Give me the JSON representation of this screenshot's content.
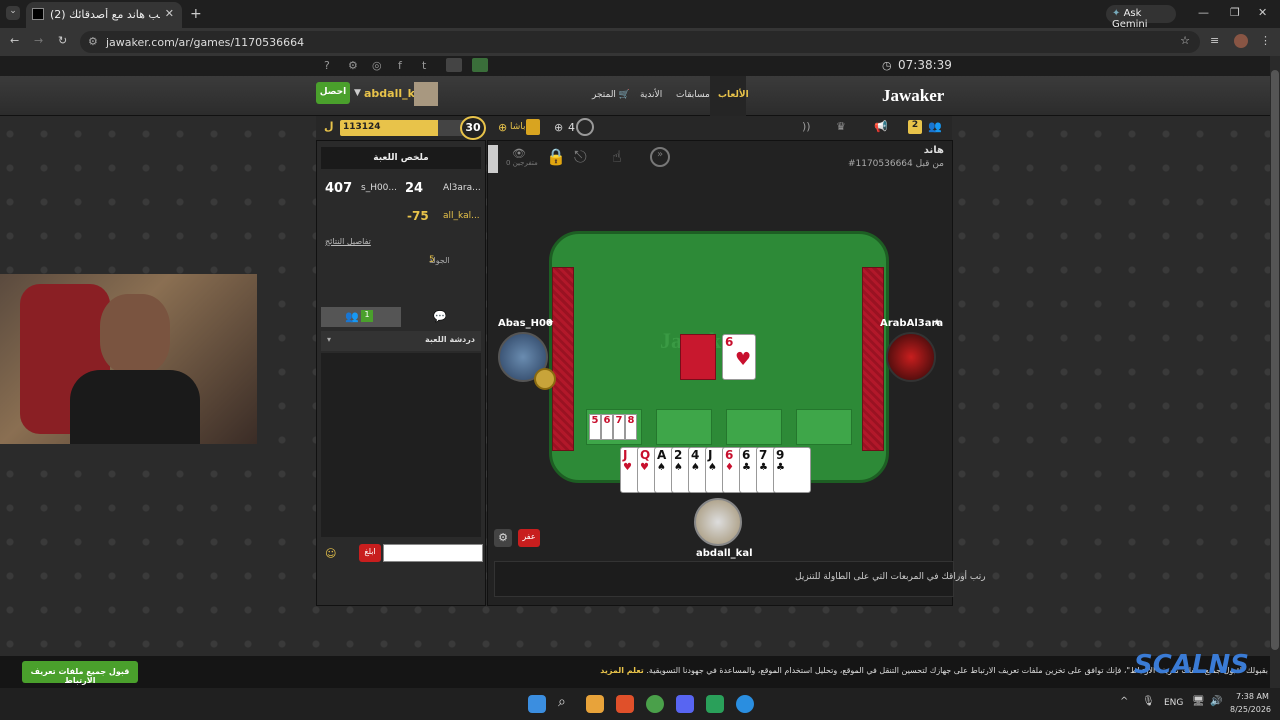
{
  "browser": {
    "tab_title": "(2) العب هاند مع أصدقائك ...",
    "url": "jawaker.com/ar/games/1170536664",
    "gemini": "Ask Gemini"
  },
  "topbar": {
    "clock": "07:38:39"
  },
  "nav": {
    "logo": "Jawaker",
    "tabs": [
      "الألعاب",
      "مسابقات",
      "الأندية",
      "المتجر"
    ],
    "username": "abdall_kal",
    "get_btn": "احصل",
    "badge_count": "2"
  },
  "status": {
    "xp": "113124",
    "level": "30",
    "level_percent": 72,
    "tokens_label": "باشا",
    "friends": "4"
  },
  "summary": {
    "title": "ملخص اللعبة",
    "team1_name": "Al3ara...",
    "team1_score": "24",
    "team2_name": "s_H00...",
    "team2_total": "407",
    "team3_name": "all_kal...",
    "team3_score": "-75",
    "details_link": "تفاصيل النتائج",
    "round_label": "الجولة",
    "round_value": "5",
    "friends_count": "1",
    "chat_title": "دردشة اللعبة",
    "send_btn": "ابلغ"
  },
  "game": {
    "title": "هاند",
    "subtitle": "#1170536664 من قبل",
    "spectators": "0 متفرجين",
    "players": {
      "left": "Abas_H00",
      "right": "ArabAl3ara",
      "bottom": "abdall_kal"
    },
    "meld_cards": [
      "5",
      "6",
      "7",
      "8"
    ],
    "discard_card": "6",
    "hand": [
      {
        "rank": "J",
        "suit": "♥",
        "red": true
      },
      {
        "rank": "Q",
        "suit": "♥",
        "red": true
      },
      {
        "rank": "A",
        "suit": "♠",
        "red": false
      },
      {
        "rank": "2",
        "suit": "♠",
        "red": false
      },
      {
        "rank": "4",
        "suit": "♠",
        "red": false
      },
      {
        "rank": "J",
        "suit": "♠",
        "red": false
      },
      {
        "rank": "6",
        "suit": "♦",
        "red": true
      },
      {
        "rank": "6",
        "suit": "♣",
        "red": false
      },
      {
        "rank": "7",
        "suit": "♣",
        "red": false
      },
      {
        "rank": "9",
        "suit": "♣",
        "red": false
      }
    ],
    "pass_btn": "عفر",
    "hint": "رتب أوراقك في المربعات التي على الطاولة للتنزيل"
  },
  "cookie": {
    "text": "بقبولك \"قبول جميع ملفات تعريف الارتباط\"، فإنك توافق على تخزين ملفات تعريف الارتباط على جهازك لتحسين التنقل في الموقع، وتحليل استخدام الموقع، والمساعدة في جهودنا التسويقية.",
    "learn_more": "تعلّم المزيد",
    "accept_btn": "قبول جميع ملفات تعريف الارتباط"
  },
  "watermark": "SCALNS",
  "taskbar": {
    "lang": "ENG",
    "time": "7:38 AM",
    "date": "8/25/2026"
  }
}
